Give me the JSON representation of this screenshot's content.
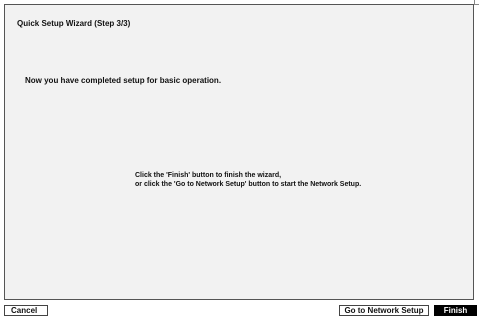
{
  "dialog": {
    "title": "Quick Setup Wizard (Step 3/3)",
    "completed_message": "Now you have completed setup for basic operation.",
    "instruction_line1": "Click the 'Finish' button to finish the wizard,",
    "instruction_line2": "or click the 'Go to Network Setup' button to start the Network Setup."
  },
  "buttons": {
    "cancel": "Cancel",
    "network_setup": "Go to Network Setup",
    "finish": "Finish"
  },
  "colors": {
    "panel_background": "#f2f2f2",
    "finish_button_background": "#000000",
    "finish_button_text": "#ffffff"
  }
}
